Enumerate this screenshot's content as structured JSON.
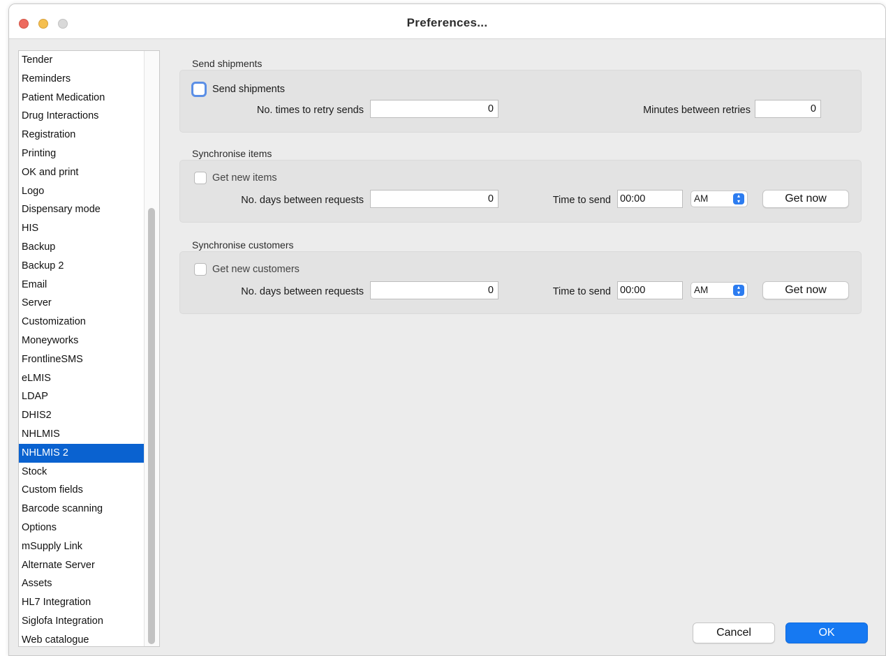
{
  "window": {
    "title": "Preferences..."
  },
  "sidebar": {
    "items": [
      {
        "label": "Tender",
        "selected": false
      },
      {
        "label": "Reminders",
        "selected": false
      },
      {
        "label": "Patient Medication",
        "selected": false
      },
      {
        "label": "Drug Interactions",
        "selected": false
      },
      {
        "label": "Registration",
        "selected": false
      },
      {
        "label": "Printing",
        "selected": false
      },
      {
        "label": "OK and print",
        "selected": false
      },
      {
        "label": "Logo",
        "selected": false
      },
      {
        "label": "Dispensary mode",
        "selected": false
      },
      {
        "label": "HIS",
        "selected": false
      },
      {
        "label": "Backup",
        "selected": false
      },
      {
        "label": "Backup 2",
        "selected": false
      },
      {
        "label": "Email",
        "selected": false
      },
      {
        "label": "Server",
        "selected": false
      },
      {
        "label": "Customization",
        "selected": false
      },
      {
        "label": "Moneyworks",
        "selected": false
      },
      {
        "label": "FrontlineSMS",
        "selected": false
      },
      {
        "label": "eLMIS",
        "selected": false
      },
      {
        "label": "LDAP",
        "selected": false
      },
      {
        "label": "DHIS2",
        "selected": false
      },
      {
        "label": "NHLMIS",
        "selected": false
      },
      {
        "label": "NHLMIS 2",
        "selected": true
      },
      {
        "label": "Stock",
        "selected": false
      },
      {
        "label": "Custom fields",
        "selected": false
      },
      {
        "label": "Barcode scanning",
        "selected": false
      },
      {
        "label": "Options",
        "selected": false
      },
      {
        "label": "mSupply Link",
        "selected": false
      },
      {
        "label": "Alternate Server",
        "selected": false
      },
      {
        "label": "Assets",
        "selected": false
      },
      {
        "label": "HL7 Integration",
        "selected": false
      },
      {
        "label": "Siglofa Integration",
        "selected": false
      },
      {
        "label": "Web catalogue",
        "selected": false
      }
    ]
  },
  "send_shipments": {
    "section_title": "Send shipments",
    "checkbox_label": "Send shipments",
    "checked": false,
    "retry_label": "No. times to retry sends",
    "retry_value": "0",
    "minutes_label": "Minutes between retries",
    "minutes_value": "0"
  },
  "sync_items": {
    "section_title": "Synchronise items",
    "checkbox_label": "Get new items",
    "checked": false,
    "days_label": "No. days between requests",
    "days_value": "0",
    "time_label": "Time to send",
    "time_value": "00:00",
    "ampm_value": "AM",
    "button_label": "Get now"
  },
  "sync_customers": {
    "section_title": "Synchronise customers",
    "checkbox_label": "Get new customers",
    "checked": false,
    "days_label": "No. days between requests",
    "days_value": "0",
    "time_label": "Time to send",
    "time_value": "00:00",
    "ampm_value": "AM",
    "button_label": "Get now"
  },
  "footer": {
    "cancel_label": "Cancel",
    "ok_label": "OK"
  },
  "colors": {
    "selection": "#0a62d0",
    "primary_button": "#1679f2",
    "group_background": "#e3e3e3"
  }
}
